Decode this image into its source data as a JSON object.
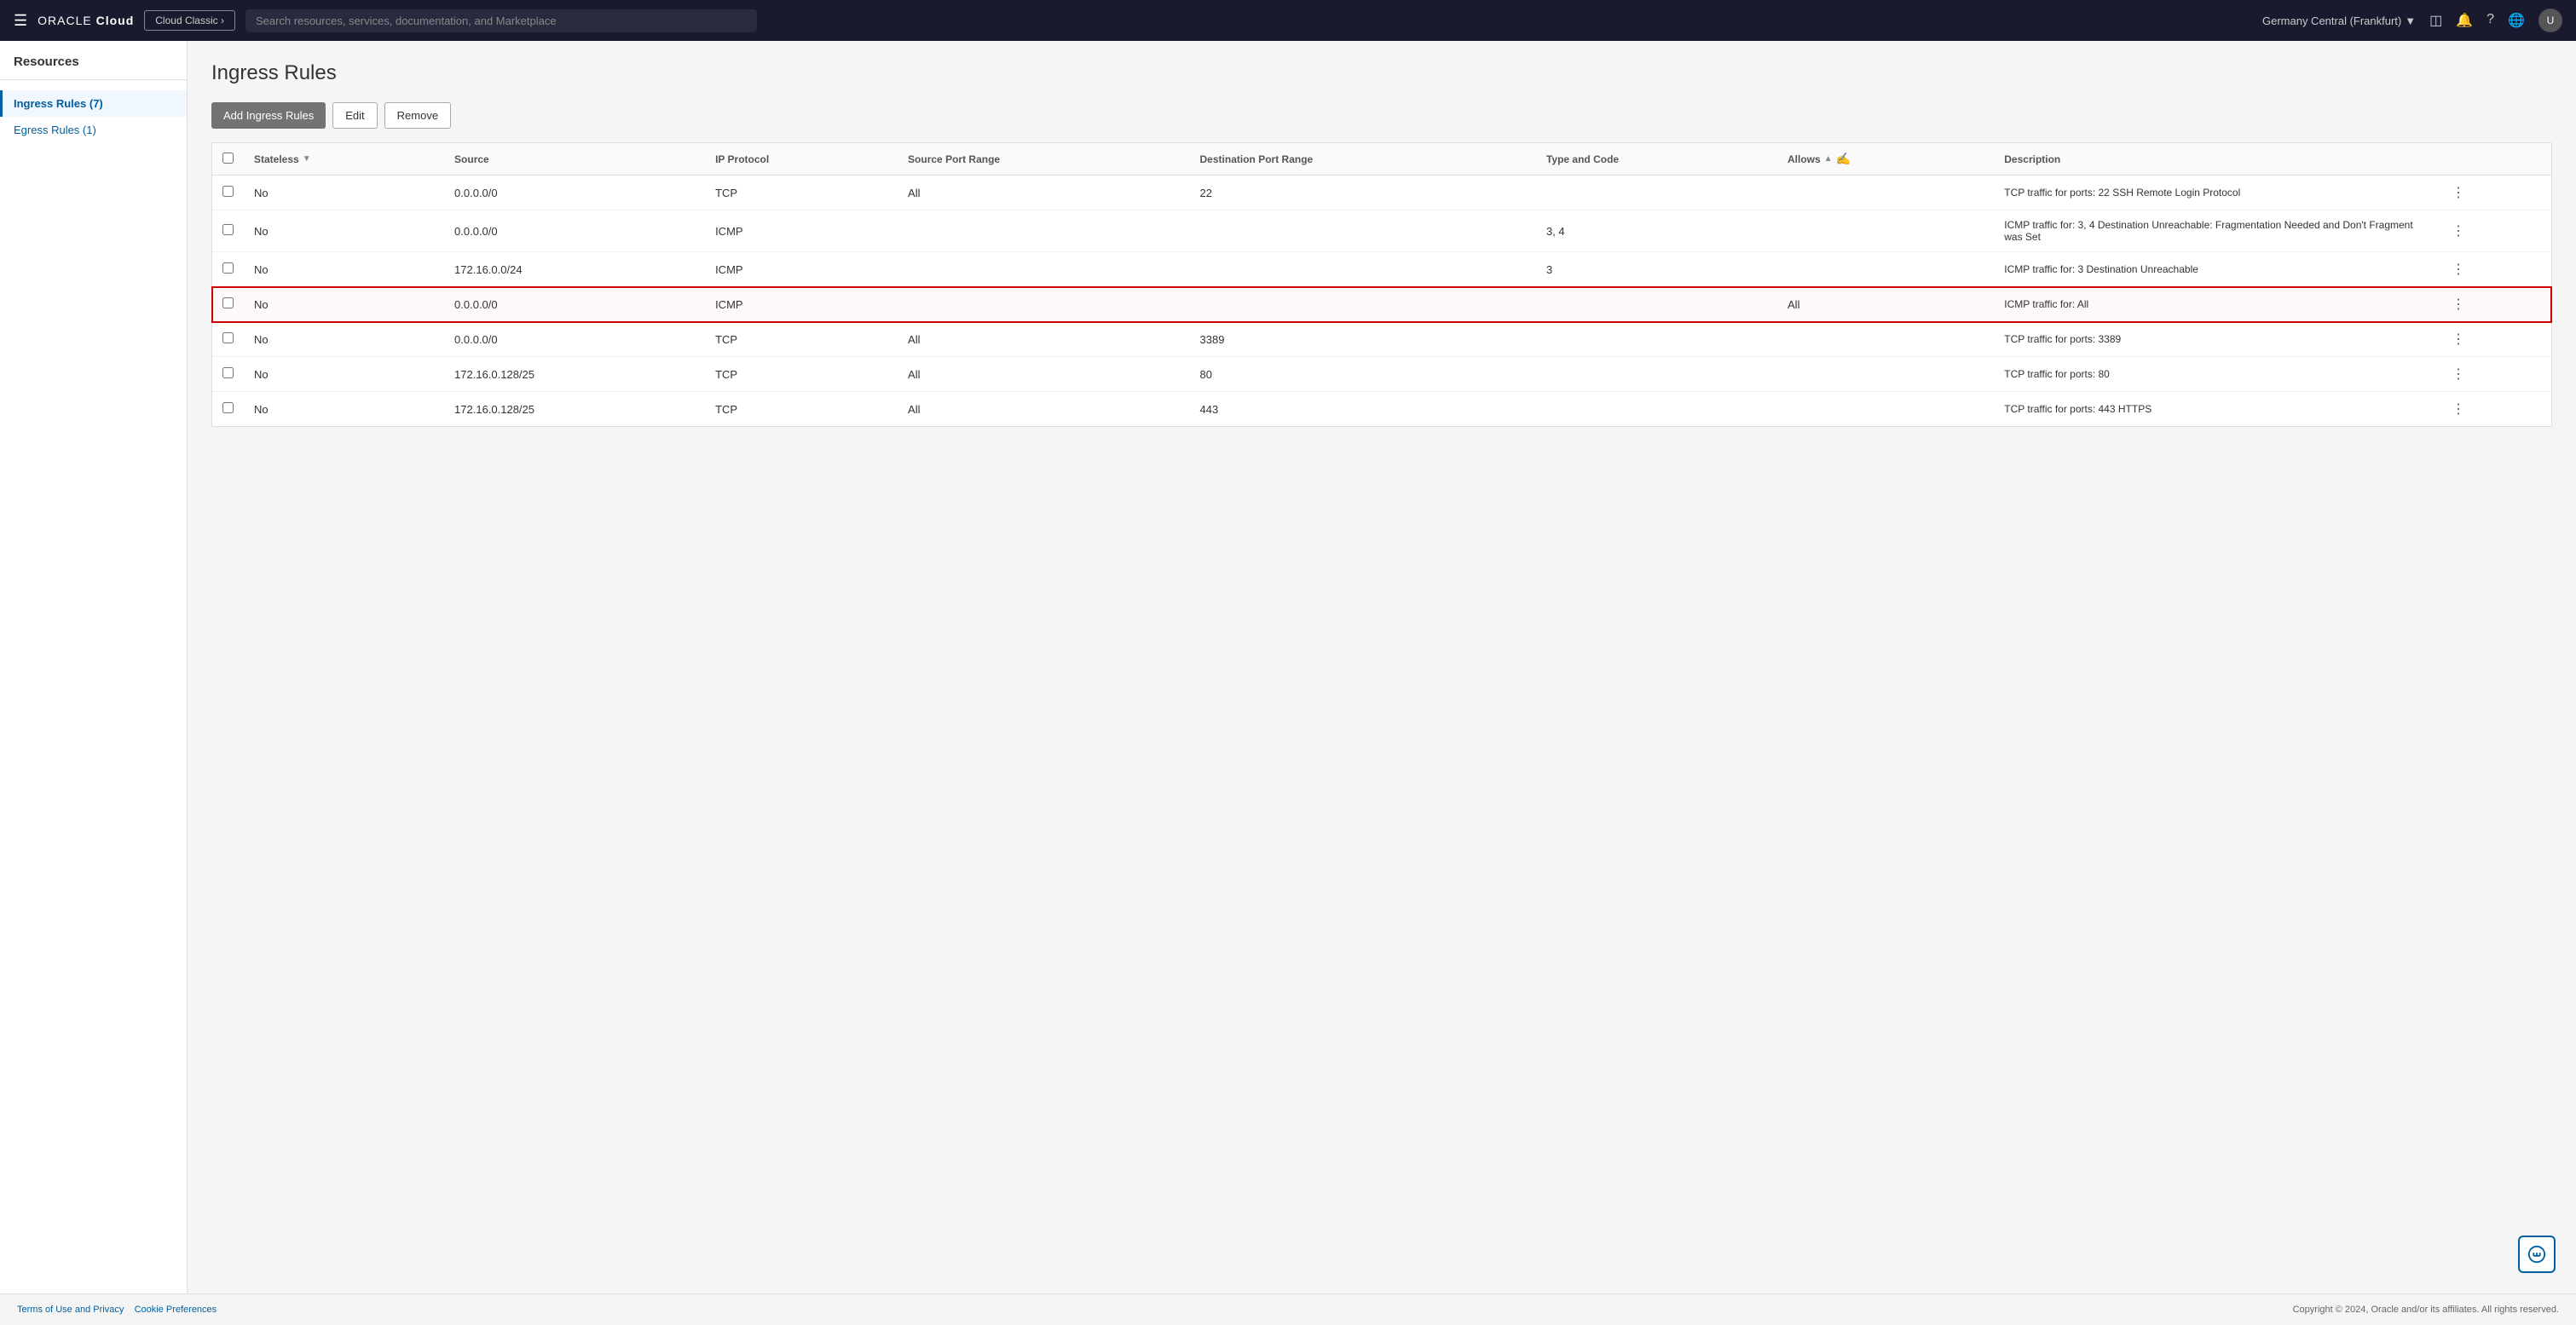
{
  "topnav": {
    "logo": "ORACLE Cloud",
    "classic_btn": "Cloud Classic ›",
    "search_placeholder": "Search resources, services, documentation, and Marketplace",
    "region": "Germany Central (Frankfurt)",
    "hamburger_icon": "☰",
    "monitor_icon": "□",
    "bell_icon": "🔔",
    "help_icon": "?",
    "globe_icon": "🌐",
    "avatar_label": "U"
  },
  "sidebar": {
    "title": "Resources",
    "items": [
      {
        "label": "Ingress Rules (7)",
        "active": true
      },
      {
        "label": "Egress Rules (1)",
        "active": false
      }
    ]
  },
  "main": {
    "page_title": "Ingress Rules",
    "toolbar": {
      "add_label": "Add Ingress Rules",
      "edit_label": "Edit",
      "remove_label": "Remove"
    },
    "table": {
      "columns": [
        "Stateless",
        "Source",
        "IP Protocol",
        "Source Port Range",
        "Destination Port Range",
        "Type and Code",
        "Allows",
        "Description"
      ],
      "rows": [
        {
          "stateless": "No",
          "source": "0.0.0.0/0",
          "ip_protocol": "TCP",
          "source_port_range": "All",
          "destination_port_range": "22",
          "type_and_code": "",
          "allows": "",
          "description": "TCP traffic for ports: 22 SSH Remote Login Protocol",
          "highlighted": false
        },
        {
          "stateless": "No",
          "source": "0.0.0.0/0",
          "ip_protocol": "ICMP",
          "source_port_range": "",
          "destination_port_range": "",
          "type_and_code": "3, 4",
          "allows": "",
          "description": "ICMP traffic for: 3, 4 Destination Unreachable: Fragmentation Needed and Don't Fragment was Set",
          "highlighted": false
        },
        {
          "stateless": "No",
          "source": "172.16.0.0/24",
          "ip_protocol": "ICMP",
          "source_port_range": "",
          "destination_port_range": "",
          "type_and_code": "3",
          "allows": "",
          "description": "ICMP traffic for: 3 Destination Unreachable",
          "highlighted": false
        },
        {
          "stateless": "No",
          "source": "0.0.0.0/0",
          "ip_protocol": "ICMP",
          "source_port_range": "",
          "destination_port_range": "",
          "type_and_code": "",
          "allows": "All",
          "description": "ICMP traffic for: All",
          "highlighted": true
        },
        {
          "stateless": "No",
          "source": "0.0.0.0/0",
          "ip_protocol": "TCP",
          "source_port_range": "All",
          "destination_port_range": "3389",
          "type_and_code": "",
          "allows": "",
          "description": "TCP traffic for ports: 3389",
          "highlighted": false
        },
        {
          "stateless": "No",
          "source": "172.16.0.128/25",
          "ip_protocol": "TCP",
          "source_port_range": "All",
          "destination_port_range": "80",
          "type_and_code": "",
          "allows": "",
          "description": "TCP traffic for ports: 80",
          "highlighted": false
        },
        {
          "stateless": "No",
          "source": "172.16.0.128/25",
          "ip_protocol": "TCP",
          "source_port_range": "All",
          "destination_port_range": "443",
          "type_and_code": "",
          "allows": "",
          "description": "TCP traffic for ports: 443 HTTPS",
          "highlighted": false
        }
      ]
    }
  },
  "footer": {
    "terms_label": "Terms of Use and Privacy",
    "cookie_label": "Cookie Preferences",
    "copyright": "Copyright © 2024, Oracle and/or its affiliates. All rights reserved."
  },
  "help_widget_icon": "⤢"
}
